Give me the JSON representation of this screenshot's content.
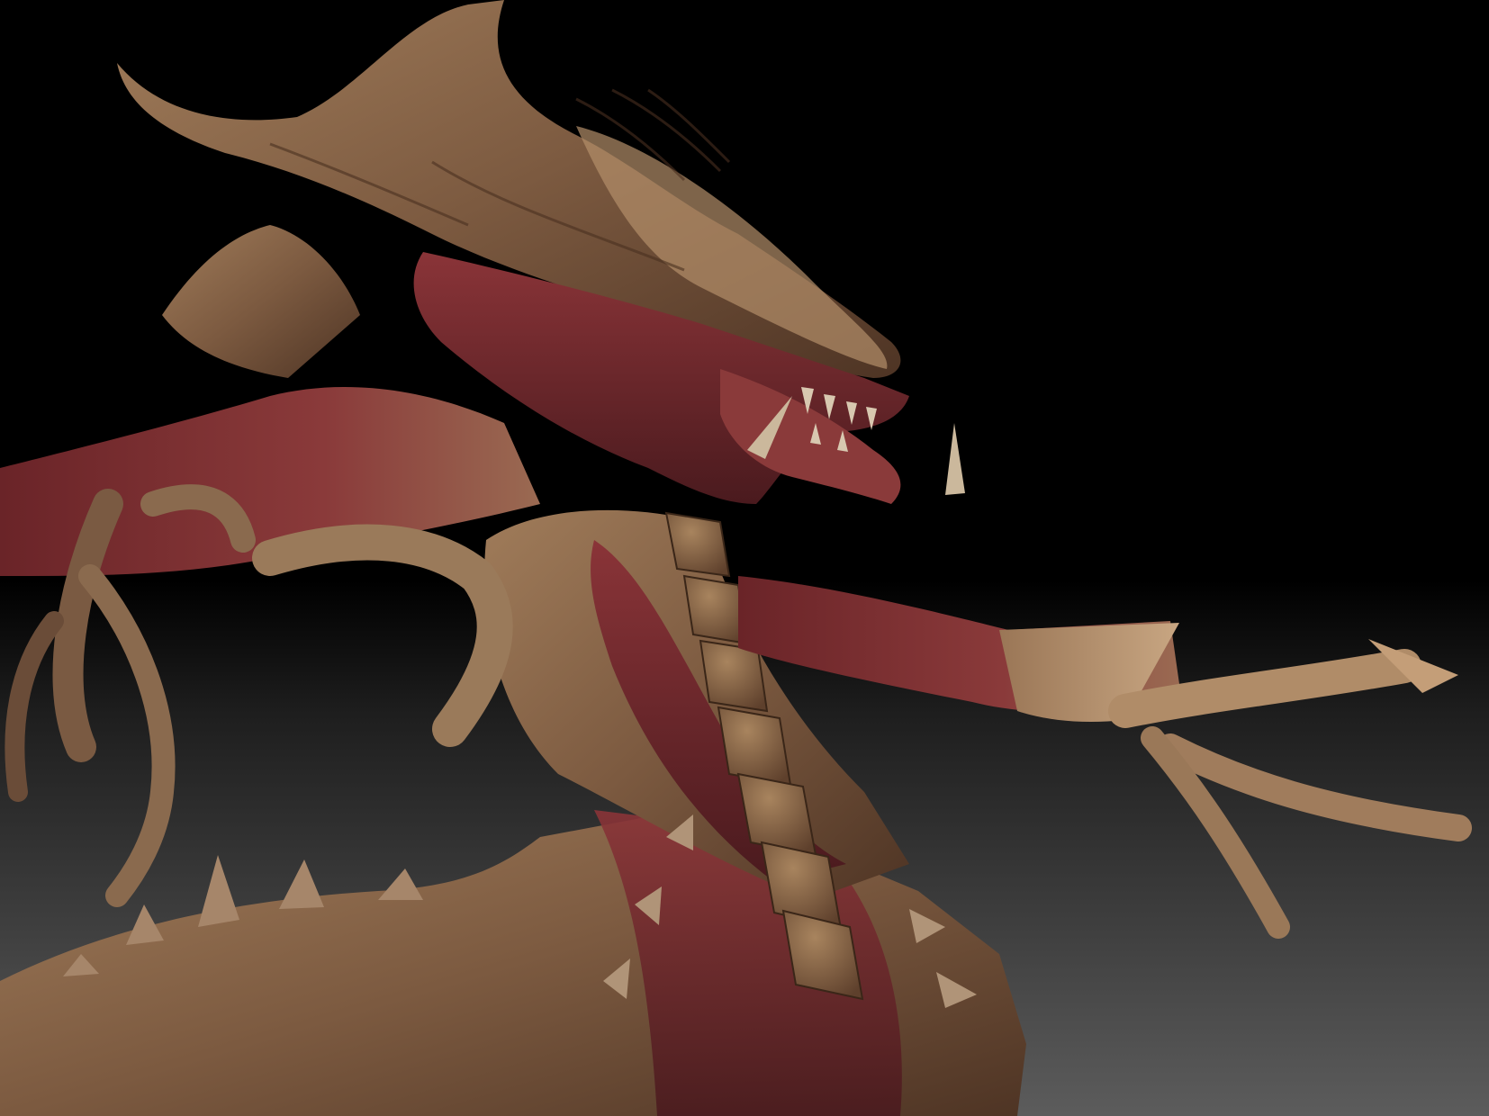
{
  "scene": {
    "background_top": "#000000",
    "background_bottom": "#5a5a5a",
    "skin_tan": "#8a6a4e",
    "skin_dark": "#5a3c2a",
    "flesh_red": "#7a2a2e",
    "flesh_dark": "#4a1a1e",
    "bone": "#c9b29a"
  }
}
